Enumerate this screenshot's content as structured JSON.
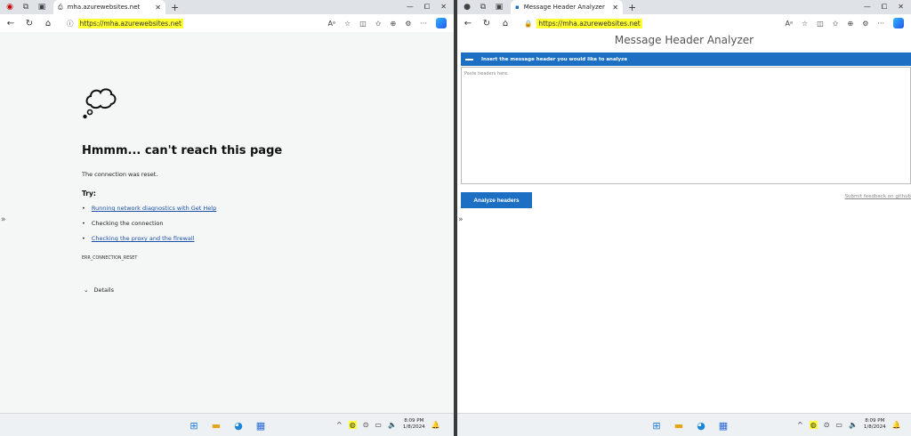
{
  "left": {
    "tab": {
      "title": "mha.azurewebsites.net"
    },
    "url": "https://mha.azurewebsites.net",
    "error": {
      "title": "Hmmm... can't reach this page",
      "description": "The connection was reset.",
      "try_label": "Try:",
      "suggestions": [
        "Running network diagnostics with Get Help",
        "Checking the connection",
        "Checking the proxy and the firewall"
      ],
      "code": "ERR_CONNECTION_RESET",
      "details_label": "Details"
    }
  },
  "right": {
    "tab": {
      "title": "Message Header Analyzer"
    },
    "url": "https://mha.azurewebsites.net",
    "app_title": "Message Header Analyzer",
    "section_label": "Insert the message header you would like to analyze",
    "paste_placeholder": "Paste headers here.",
    "analyze_label": "Analyze headers",
    "feedback_link": "Submit feedback on github"
  },
  "taskbar": {
    "time": "8:09 PM",
    "date": "1/8/2024"
  },
  "colors": {
    "accent": "#1d6fc4",
    "url_highlight": "#ffff33"
  }
}
